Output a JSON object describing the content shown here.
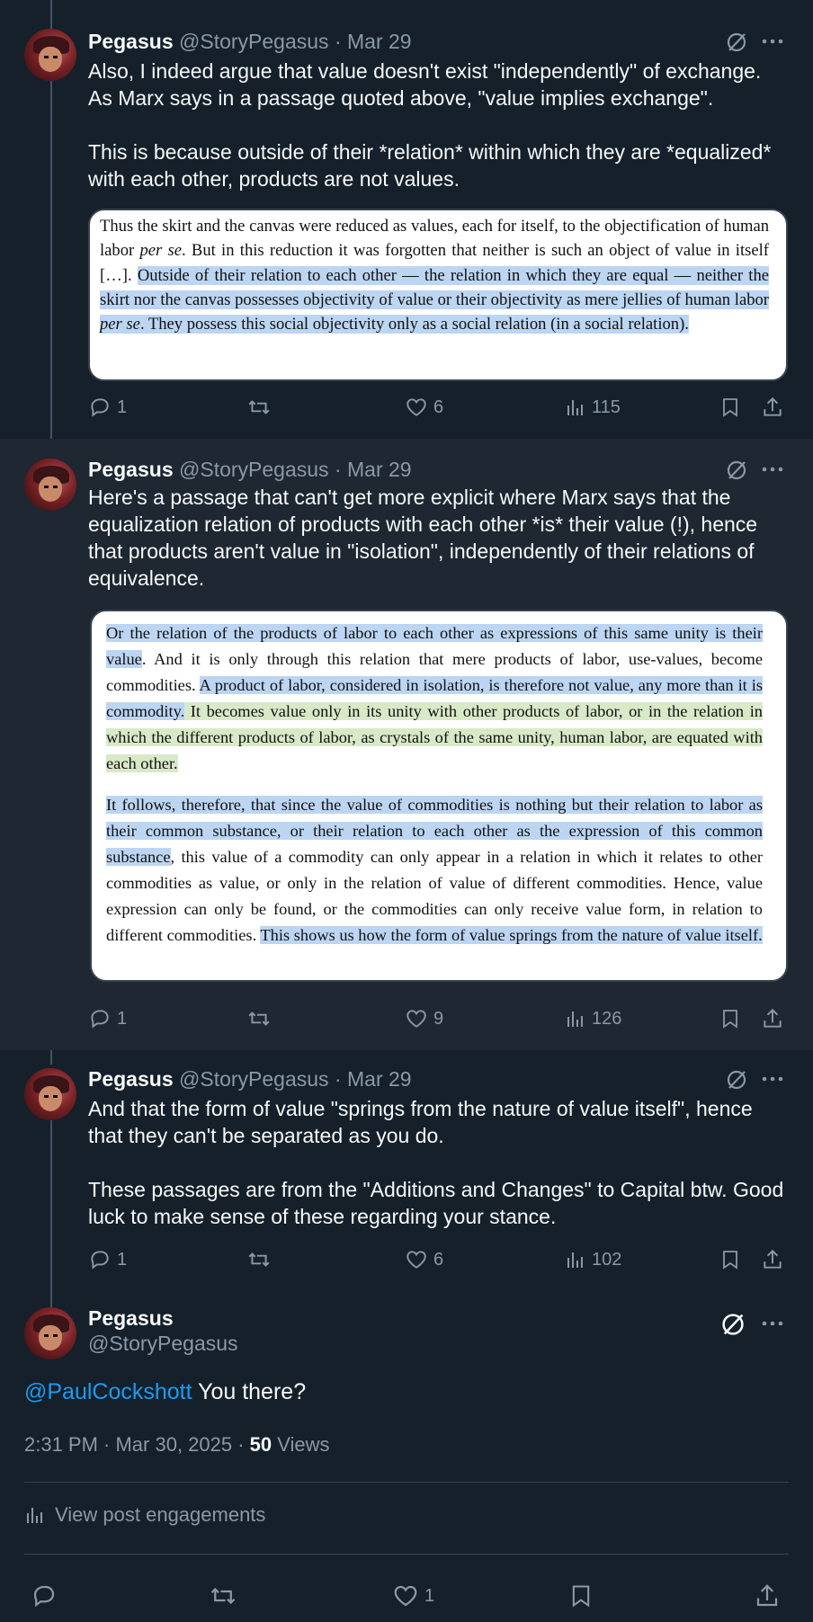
{
  "tweets": [
    {
      "name": "Pegasus",
      "handle": "@StoryPegasus",
      "date": "· Mar 29",
      "text": [
        "Also, I indeed argue that value doesn't exist \"independently\" of exchange. As Marx says in a passage quoted above, \"value implies exchange\".",
        "This is because outside of their *relation* within which they are *equalized* with each other, products are not values."
      ],
      "quote": {
        "part1": "Thus the skirt and the canvas were reduced as values, each for itself, to the objectification of human labor ",
        "part1_italic": "per se",
        "part2": ". But in this reduction it was forgotten that neither is such an object of value in itself […]. ",
        "hl1": "Outside of their relation to each other — the relation in which they are equal — neither the skirt nor the canvas possesses objectivity of value or their objectivity as mere jellies of human labor ",
        "hl1_italic": "per se",
        "hl2": ". They possess this social objectivity only as a social relation (in a social relation)."
      },
      "replies": "1",
      "likes": "6",
      "views": "115"
    },
    {
      "name": "Pegasus",
      "handle": "@StoryPegasus",
      "date": "· Mar 29",
      "text": [
        "Here's a passage that can't get more explicit where Marx says that the equalization relation of products with each other *is* their value (!), hence that products aren't value in \"isolation\", independently of their relations of equivalence."
      ],
      "quote": {
        "p1_hl": "Or the relation of the products of labor to each other as expressions of this same unity is their value",
        "p1_a": ". And it is only through this relation that mere products of labor, use-values, become commodities. ",
        "p1_hl2": "A product of labor, considered in isolation, is therefore not value, any more than it is commodity.",
        "p1_green": " It becomes value only in its unity with other products of labor, or in the relation in which the different products of labor, as crystals of the same unity, human labor, are equated with each other.",
        "p2_hl": "It follows, therefore, that since the value of commodities is nothing but their relation to labor as their common substance, or their relation to each other as the expression of this common substance",
        "p2_a": ", this value of a commodity can only appear in a relation in which it relates to other commodities as value, or only in the relation of value of different commodities. Hence, value expression can only be found, or the commodities can only receive value form, in relation to different commodities. ",
        "p2_hl2": "This shows us how the form of value springs from the nature of value itself."
      },
      "replies": "1",
      "likes": "9",
      "views": "126"
    },
    {
      "name": "Pegasus",
      "handle": "@StoryPegasus",
      "date": "· Mar 29",
      "text": [
        "And that the form of value \"springs from the nature of value itself\", hence that they can't be separated as you do.",
        "These passages are from the \"Additions and Changes\" to Capital btw. Good luck to make sense of these regarding your stance."
      ],
      "replies": "1",
      "likes": "6",
      "views": "102"
    }
  ],
  "focused": {
    "name": "Pegasus",
    "handle": "@StoryPegasus",
    "mention": "@PaulCockshott",
    "text": " You there?",
    "timestamp": "2:31 PM · Mar 30, 2025 · ",
    "views_count": "50",
    "views_label": " Views",
    "engagements": "View post engagements",
    "likes": "1"
  }
}
